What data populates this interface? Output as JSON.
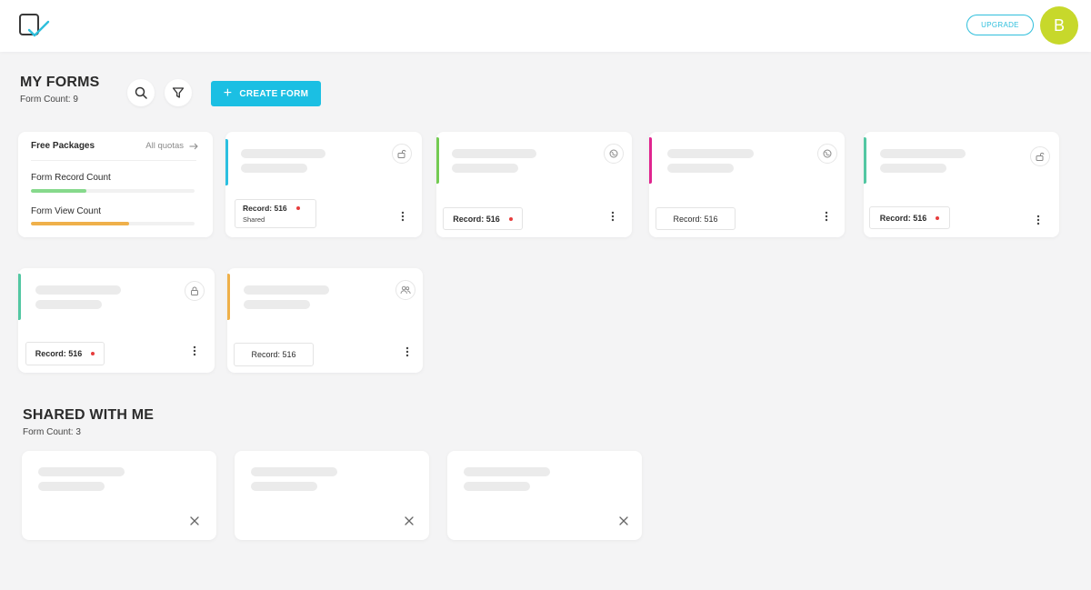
{
  "header": {
    "upgrade_label": "UPGRADE",
    "avatar_initial": "B"
  },
  "my_forms": {
    "title": "MY FORMS",
    "count_label": "Form Count: 9",
    "create_label": "CREATE FORM"
  },
  "package": {
    "title": "Free Packages",
    "link_label": "All quotas",
    "metrics": [
      {
        "label": "Form Record Count",
        "value": 0.34,
        "color": "#86d98c"
      },
      {
        "label": "Form View Count",
        "value": 0.6,
        "color": "#efb04a"
      }
    ]
  },
  "forms": [
    {
      "accent": "#2bbfe0",
      "icon": "unlock-icon",
      "record": "Record: 516",
      "status": "Shared",
      "dot": true
    },
    {
      "accent": "#73cb52",
      "icon": "globe-icon",
      "record": "Record: 516",
      "dot": true
    },
    {
      "accent": "#e0258f",
      "icon": "globe-icon",
      "record": "Record: 516",
      "dot": false
    },
    {
      "accent": "#52c7a2",
      "icon": "unlock-icon",
      "record": "Record: 516",
      "dot": true
    },
    {
      "accent": "#52c7a2",
      "icon": "lock-icon",
      "record": "Record: 516",
      "dot": true
    },
    {
      "accent": "#efb04a",
      "icon": "users-icon",
      "record": "Record: 516",
      "dot": false
    }
  ],
  "shared": {
    "title": "SHARED WITH ME",
    "count_label": "Form Count: 3"
  }
}
